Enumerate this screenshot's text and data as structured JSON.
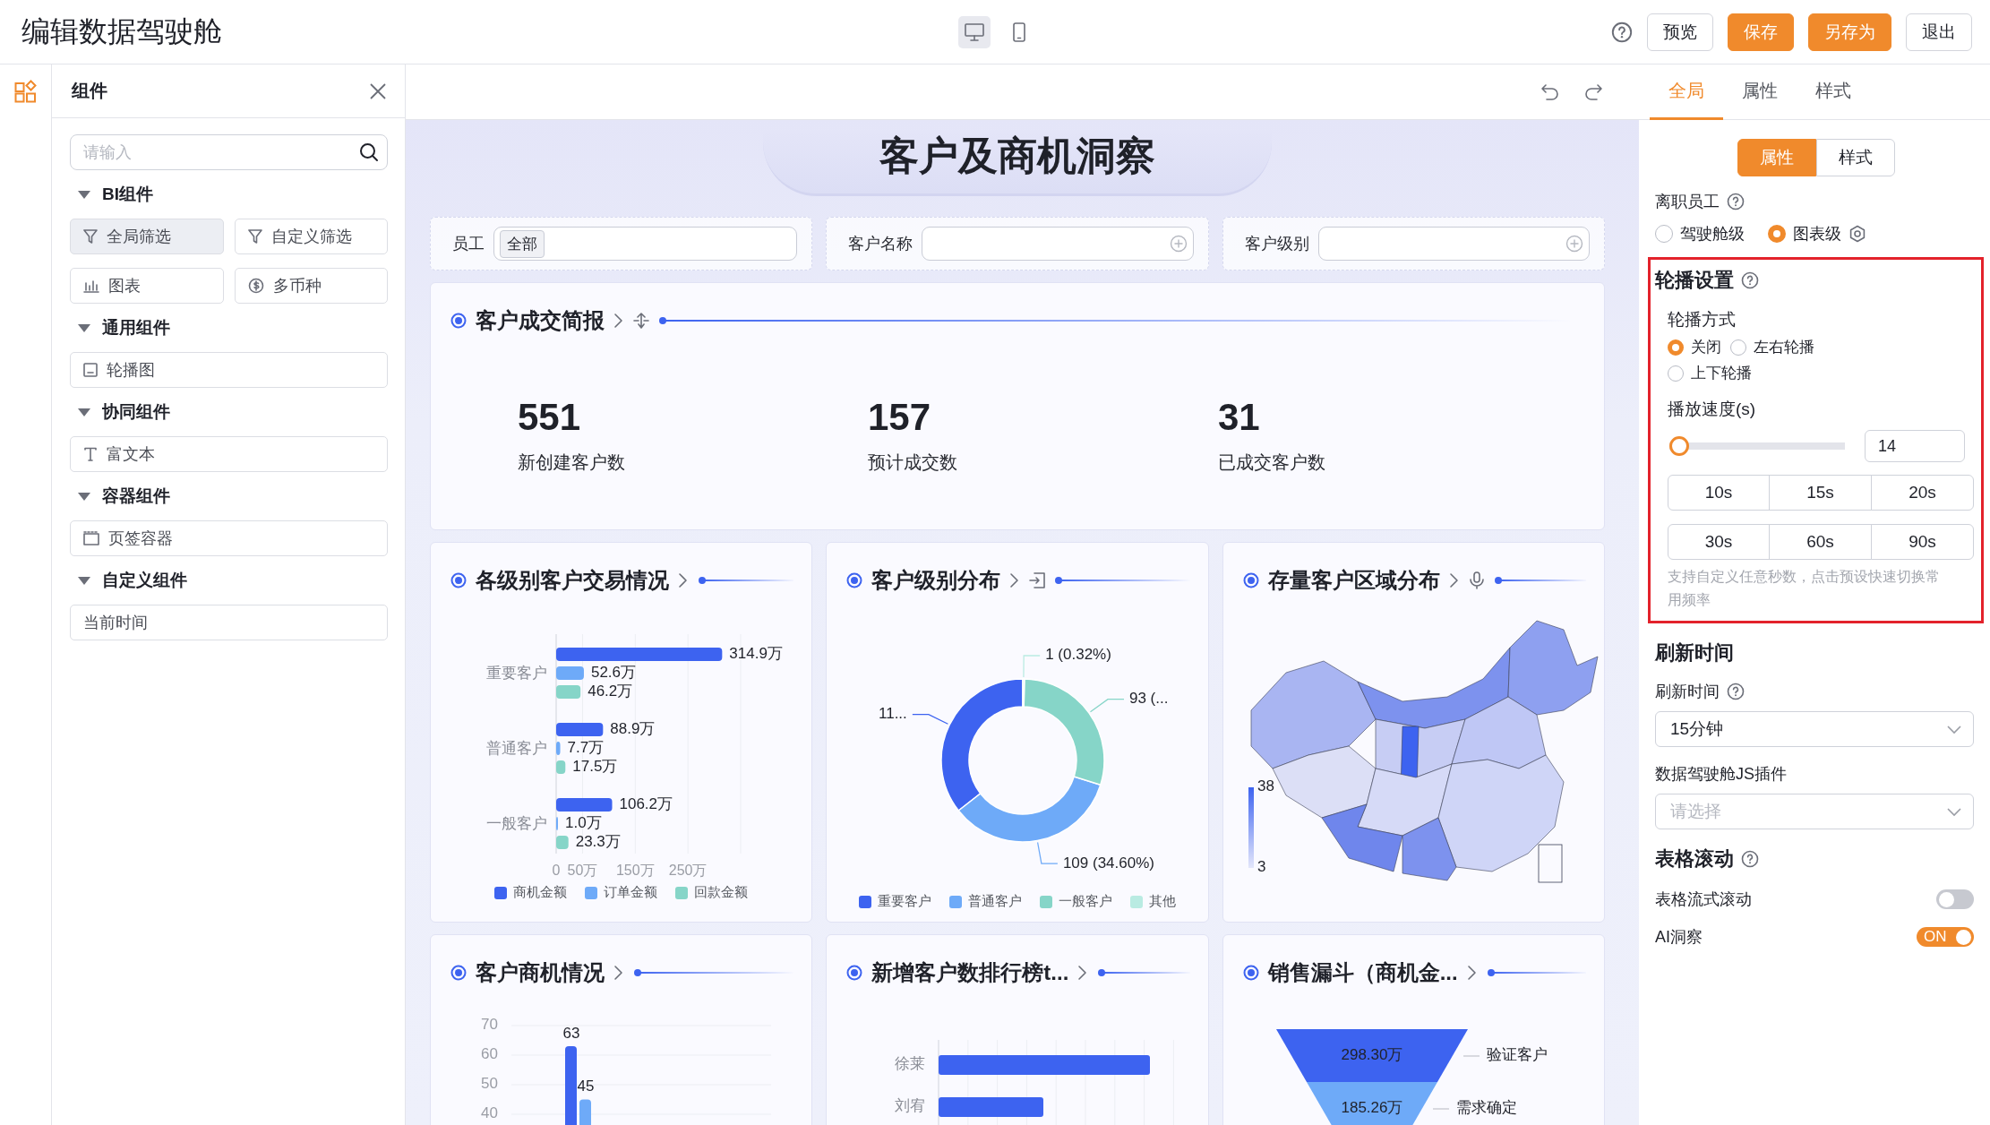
{
  "header": {
    "title": "编辑数据驾驶舱",
    "devices": [
      {
        "kind": "desktop",
        "selected": true
      },
      {
        "kind": "mobile",
        "selected": false
      }
    ],
    "help": true,
    "actions": [
      {
        "label": "预览",
        "primary": false
      },
      {
        "label": "保存",
        "primary": true
      },
      {
        "label": "另存为",
        "primary": true
      },
      {
        "label": "退出",
        "primary": false
      }
    ]
  },
  "components": {
    "title": "组件",
    "search": {
      "placeholder": "请输入"
    },
    "groups": [
      {
        "title": "BI组件",
        "expanded": true,
        "items": [
          {
            "label": "全局筛选",
            "kind": "filter",
            "selected": true
          },
          {
            "label": "自定义筛选",
            "kind": "filter",
            "selected": false
          },
          {
            "label": "图表",
            "kind": "chart",
            "selected": false
          },
          {
            "label": "多币种",
            "kind": "currency",
            "selected": false
          }
        ]
      },
      {
        "title": "通用组件",
        "expanded": true,
        "items": [
          {
            "label": "轮播图",
            "kind": "carousel",
            "selected": false
          }
        ]
      },
      {
        "title": "协同组件",
        "expanded": true,
        "items": [
          {
            "label": "富文本",
            "kind": "text",
            "selected": false
          }
        ]
      },
      {
        "title": "容器组件",
        "expanded": true,
        "items": [
          {
            "label": "页签容器",
            "kind": "tabs",
            "selected": false
          }
        ]
      },
      {
        "title": "自定义组件",
        "expanded": true,
        "items": [
          {
            "label": "当前时间",
            "kind": "plain",
            "selected": false
          }
        ]
      }
    ]
  },
  "canvas": {
    "title": "客户及商机洞察",
    "filters": [
      {
        "label": "员工",
        "tag": "全部"
      },
      {
        "label": "客户名称",
        "addable": true
      },
      {
        "label": "客户级别",
        "addable": true
      }
    ],
    "summary": {
      "title": "客户成交简报",
      "tool": {
        "kind": "sort"
      },
      "kpis": [
        {
          "value": "551",
          "label": "新创建客户数"
        },
        {
          "value": "157",
          "label": "预计成交数"
        },
        {
          "value": "31",
          "label": "已成交客户数"
        }
      ]
    },
    "cards": [
      {
        "title": "各级别客户交易情况",
        "chart_data": {
          "type": "bar",
          "orientation": "horizontal",
          "categories": [
            "重要客户",
            "普通客户",
            "一般客户"
          ],
          "xlim": [
            0,
            350
          ],
          "xticks": [
            {
              "value": 0,
              "label": "0"
            },
            {
              "value": 50,
              "label": "50万"
            },
            {
              "value": 150,
              "label": "150万"
            },
            {
              "value": 250,
              "label": "250万"
            }
          ],
          "grid": true,
          "data_labels": true,
          "series": [
            {
              "name": "商机金额",
              "color": "#3d63f0",
              "values": [
                314.9,
                88.9,
                106.2
              ],
              "value_labels": [
                "314.9万",
                "88.9万",
                "106.2万"
              ]
            },
            {
              "name": "订单金额",
              "color": "#6eaaf8",
              "values": [
                52.6,
                7.7,
                1.0
              ],
              "value_labels": [
                "52.6万",
                "7.7万",
                "1.0万"
              ]
            },
            {
              "name": "回款金额",
              "color": "#86d5c8",
              "values": [
                46.2,
                17.5,
                23.3
              ],
              "value_labels": [
                "46.2万",
                "17.5万",
                "23.3万"
              ]
            }
          ]
        }
      },
      {
        "title": "客户级别分布",
        "tool": {
          "kind": "export"
        },
        "chart_data": {
          "type": "donut",
          "categories": [
            "重要客户",
            "普通客户",
            "一般客户",
            "其他"
          ],
          "values": [
            112,
            109,
            93,
            1
          ],
          "colors": [
            "#3d63f0",
            "#6eaaf8",
            "#86d5c8",
            "#b9ebe2"
          ],
          "value_labels": [
            "11...",
            "109 (34.60%)",
            "93 (...",
            "1 (0.32%)"
          ]
        }
      },
      {
        "kind": "map",
        "title": "存量客户区域分布",
        "tool": {
          "kind": "pin"
        },
        "legend_max": "38",
        "legend_min": "3"
      },
      {
        "title": "客户商机情况",
        "chart_data": {
          "type": "bar",
          "ylim": [
            0,
            70
          ],
          "yticks": [
            40,
            50,
            60,
            70
          ],
          "grid": true,
          "data_labels": true,
          "series": [
            {
              "color": "#3d63f0",
              "values": [
                63
              ]
            },
            {
              "color": "#6eaaf8",
              "values": [
                45
              ]
            }
          ]
        }
      },
      {
        "kind": "ranking",
        "title": "新增客户数排行榜t...",
        "labels": [
          "徐莱",
          "刘宥"
        ]
      },
      {
        "kind": "funnel",
        "title": "销售漏斗（商机金...",
        "stages": [
          {
            "value": "298.30万",
            "name": "验证客户",
            "color": "#3d63f0"
          },
          {
            "value": "185.26万",
            "name": "需求确定",
            "color": "#6eaaf8"
          }
        ]
      }
    ]
  },
  "settings": {
    "tabs": [
      {
        "label": "全局",
        "selected": true
      },
      {
        "label": "属性",
        "selected": false
      },
      {
        "label": "样式",
        "selected": false
      }
    ],
    "segments": [
      {
        "label": "属性",
        "selected": true
      },
      {
        "label": "样式",
        "selected": false
      }
    ],
    "resigned": {
      "label": "离职员工",
      "help": true,
      "options": [
        {
          "label": "驾驶舱级",
          "selected": false
        },
        {
          "label": "图表级",
          "selected": true,
          "settings": true
        }
      ]
    },
    "carousel": {
      "title": "轮播设置",
      "help": true,
      "highlighted": true,
      "mode_label": "轮播方式",
      "modes": [
        {
          "label": "关闭",
          "selected": true
        },
        {
          "label": "左右轮播",
          "selected": false
        },
        {
          "label": "上下轮播",
          "selected": false
        }
      ],
      "speed_label": "播放速度(s)",
      "speed": {
        "level": 0,
        "value": "14"
      },
      "presets": [
        "10s",
        "15s",
        "20s",
        "30s",
        "60s",
        "90s"
      ],
      "hint": "支持自定义任意秒数，点击预设快速切换常用频率"
    },
    "refresh": {
      "title": "刷新时间",
      "label": "刷新时间",
      "help": true,
      "value": "15分钟"
    },
    "plugin": {
      "label": "数据驾驶舱JS插件",
      "placeholder": "请选择"
    },
    "scroll": {
      "title": "表格滚动",
      "help": true,
      "toggles": [
        {
          "label": "表格流式滚动",
          "on": false
        },
        {
          "label": "AI洞察",
          "on": true,
          "text": "ON"
        }
      ]
    }
  }
}
